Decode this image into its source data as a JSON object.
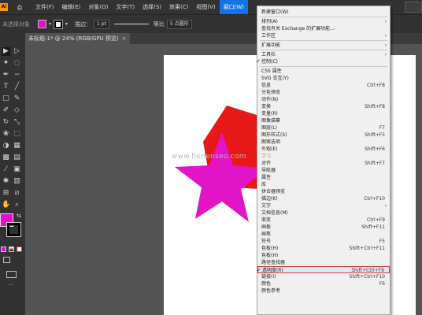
{
  "menubar": {
    "app_logo": "Ai",
    "home_icon": "home-icon",
    "items": [
      "文件(F)",
      "编辑(E)",
      "对象(O)",
      "文字(T)",
      "选择(S)",
      "效果(C)",
      "视图(V)",
      "窗口(W)"
    ]
  },
  "controlbar": {
    "no_selection": "未选择对象",
    "fill_color": "#e30fc9",
    "stroke_label": "描边：",
    "stroke_value": "1 pt",
    "stroke_style": "等比",
    "brush": "5 点圆形"
  },
  "tab": {
    "title": "未标题-1* @ 24% (RGB/GPU 预览)",
    "close": "×"
  },
  "watermark": "www.henenseo.com",
  "colors": {
    "red_shape": "#e81818",
    "magenta_shape": "#e214c7",
    "highlight_border": "#d33333"
  },
  "window_menu": {
    "items": [
      {
        "label": "新建窗口(W)",
        "shortcut": ""
      },
      {
        "sep": true
      },
      {
        "label": "排列(A)",
        "shortcut": "",
        "arrow": true
      },
      {
        "label": "查找有关 Exchange 的扩展功能...",
        "shortcut": ""
      },
      {
        "label": "工作区",
        "shortcut": "",
        "arrow": true
      },
      {
        "sep": true
      },
      {
        "label": "扩展功能",
        "shortcut": "",
        "arrow": true
      },
      {
        "sep": true
      },
      {
        "label": "工具栏",
        "shortcut": "",
        "arrow": true
      },
      {
        "label": "控制(C)",
        "shortcut": "",
        "checked": true
      },
      {
        "sep": true
      },
      {
        "label": "CSS 属性",
        "shortcut": ""
      },
      {
        "label": "SVG 交互(Y)",
        "shortcut": ""
      },
      {
        "label": "信息",
        "shortcut": "Ctrl+F8"
      },
      {
        "label": "分色预览",
        "shortcut": ""
      },
      {
        "label": "动作(N)",
        "shortcut": ""
      },
      {
        "label": "变换",
        "shortcut": "Shift+F8"
      },
      {
        "label": "变量(R)",
        "shortcut": ""
      },
      {
        "label": "图像描摹",
        "shortcut": ""
      },
      {
        "label": "图层(L)",
        "shortcut": "F7"
      },
      {
        "label": "图形样式(S)",
        "shortcut": "Shift+F5"
      },
      {
        "label": "图案选项",
        "shortcut": ""
      },
      {
        "label": "外观(E)",
        "shortcut": "Shift+F6"
      },
      {
        "label": "学习",
        "shortcut": "",
        "disabled": true
      },
      {
        "label": "对齐",
        "shortcut": "Shift+F7"
      },
      {
        "label": "导航器",
        "shortcut": ""
      },
      {
        "label": "属性",
        "shortcut": ""
      },
      {
        "label": "库",
        "shortcut": ""
      },
      {
        "label": "拼合器预览",
        "shortcut": ""
      },
      {
        "label": "描边(K)",
        "shortcut": "Ctrl+F10"
      },
      {
        "label": "文字",
        "shortcut": "",
        "arrow": true
      },
      {
        "label": "文档信息(M)",
        "shortcut": ""
      },
      {
        "label": "渐变",
        "shortcut": "Ctrl+F9"
      },
      {
        "label": "画板",
        "shortcut": "Shift+F11"
      },
      {
        "label": "画笔",
        "shortcut": ""
      },
      {
        "label": "符号",
        "shortcut": "F5"
      },
      {
        "label": "色板(H)",
        "shortcut": "Shift+Ctrl+F11"
      },
      {
        "label": "色板(H)",
        "shortcut": ""
      },
      {
        "label": "路径查找器",
        "shortcut": ""
      },
      {
        "label": "透明度(R)",
        "shortcut": "Shift+Ctrl+F9",
        "checked": true,
        "highlight": true
      },
      {
        "label": "链接(I)",
        "shortcut": "Shift+Ctrl+F10"
      },
      {
        "label": "颜色",
        "shortcut": "F6"
      },
      {
        "label": "颜色参考",
        "shortcut": ""
      }
    ]
  }
}
